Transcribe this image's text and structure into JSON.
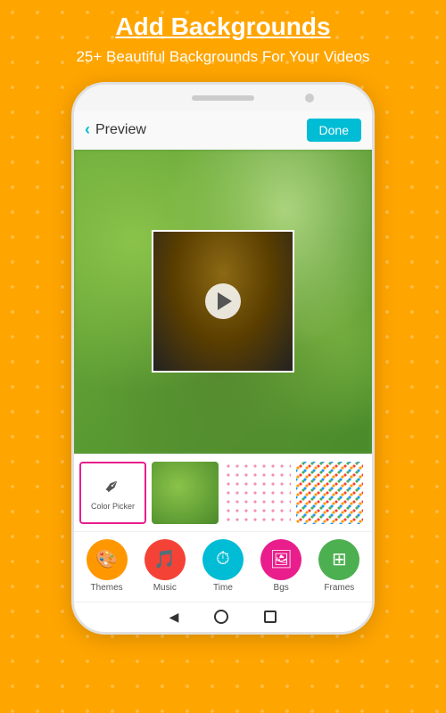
{
  "header": {
    "title": "Add Backgrounds",
    "subtitle": "25+ Beautiful Backgrounds For Your Videos"
  },
  "app": {
    "preview_label": "Preview",
    "done_button": "Done"
  },
  "thumbnails": [
    {
      "id": "color-picker",
      "label": "Color Picker",
      "selected": true
    },
    {
      "id": "green-nature",
      "label": "",
      "selected": false
    },
    {
      "id": "pink-dots",
      "label": "",
      "selected": false
    },
    {
      "id": "multi-dots",
      "label": "",
      "selected": false
    }
  ],
  "bottom_nav": [
    {
      "id": "themes",
      "label": "Themes",
      "icon": "🎨",
      "color": "orange"
    },
    {
      "id": "music",
      "label": "Music",
      "icon": "🎵",
      "color": "red"
    },
    {
      "id": "time",
      "label": "Time",
      "icon": "⏱",
      "color": "cyan"
    },
    {
      "id": "bgs",
      "label": "Bgs",
      "icon": "🖼",
      "color": "pink"
    },
    {
      "id": "frames",
      "label": "Frames",
      "icon": "⊞",
      "color": "green"
    }
  ]
}
